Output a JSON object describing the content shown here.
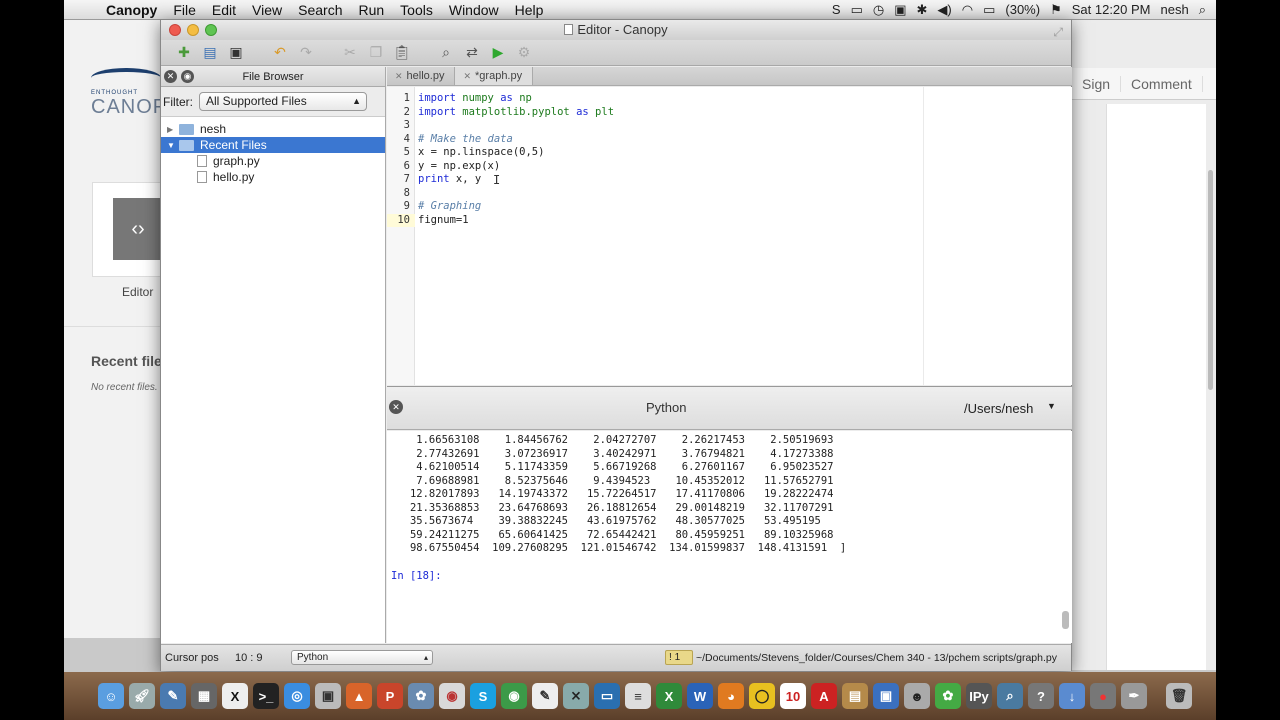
{
  "menubar": {
    "apple": "",
    "app": "Canopy",
    "items": [
      "File",
      "Edit",
      "View",
      "Search",
      "Run",
      "Tools",
      "Window",
      "Help"
    ],
    "battery": "(30%)",
    "clock": "Sat 12:20 PM",
    "user": "nesh"
  },
  "welcome": {
    "logo_small": "ENTHOUGHT",
    "logo_big": "CANOP",
    "editor_label": "Editor",
    "recent_files": "Recent file",
    "no_recent": "No recent files."
  },
  "rightdoc": {
    "sign": "Sign",
    "comment": "Comment"
  },
  "window": {
    "title": "Editor - Canopy"
  },
  "file_browser": {
    "title": "File Browser",
    "filter_label": "Filter:",
    "filter_value": "All Supported Files",
    "tree": [
      {
        "label": "nesh",
        "type": "folder"
      },
      {
        "label": "Recent Files",
        "type": "folder",
        "selected": true
      },
      {
        "label": "graph.py",
        "type": "file"
      },
      {
        "label": "hello.py",
        "type": "file"
      }
    ]
  },
  "tabs": [
    {
      "label": "hello.py",
      "active": false
    },
    {
      "label": "*graph.py",
      "active": true
    }
  ],
  "code": [
    {
      "n": "1",
      "html": "<span class=\"kw\">import</span> <span class=\"nm\">numpy</span> <span class=\"kw\">as</span> <span class=\"nm\">np</span>"
    },
    {
      "n": "2",
      "html": "<span class=\"kw\">import</span> <span class=\"nm\">matplotlib.pyplot</span> <span class=\"kw\">as</span> <span class=\"nm\">plt</span>"
    },
    {
      "n": "3",
      "html": ""
    },
    {
      "n": "4",
      "html": "<span class=\"cm\"># Make the data</span>"
    },
    {
      "n": "5",
      "html": "x = np.linspace(0,5)"
    },
    {
      "n": "6",
      "html": "y = np.exp(x)"
    },
    {
      "n": "7",
      "html": "<span class=\"kw\">print</span> x, y"
    },
    {
      "n": "8",
      "html": ""
    },
    {
      "n": "9",
      "html": "<span class=\"cm\"># Graphing</span>"
    },
    {
      "n": "10",
      "html": "fignum=1"
    }
  ],
  "python_pane": {
    "title": "Python",
    "directory": "/Users/nesh",
    "output": "    1.66563108    1.84456762    2.04272707    2.26217453    2.50519693\n    2.77432691    3.07236917    3.40242971    3.76794821    4.17273388\n    4.62100514    5.11743359    5.66719268    6.27601167    6.95023527\n    7.69688981    8.52375646    9.4394523    10.45352012   11.57652791\n   12.82017893   14.19743372   15.72264517   17.41170806   19.28222474\n   21.35368853   23.64768693   26.18812654   29.00148219   32.11707291\n   35.5673674    39.38832245   43.61975762   48.30577025   53.495195\n   59.24211275   65.60641425   72.65442421   80.45959251   89.10325968\n   98.67550454  109.27608295  121.01546742  134.01599837  148.4131591  ]",
    "prompt": "In [18]:"
  },
  "status": {
    "cursor_label": "Cursor pos",
    "cursor_value": "10 : 9",
    "language": "Python",
    "warnings": "1",
    "path": "~/Documents/Stevens_folder/Courses/Chem 340 - 13/pchem scripts/graph.py"
  }
}
